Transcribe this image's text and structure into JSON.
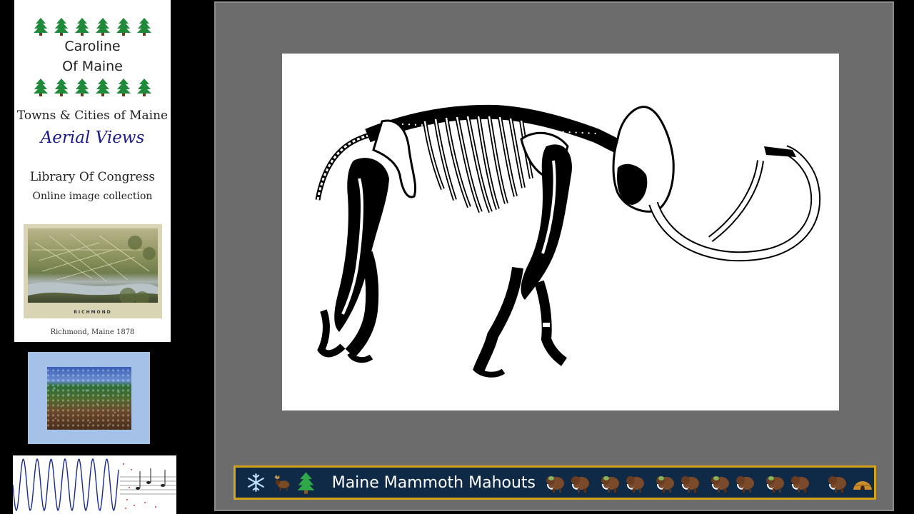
{
  "card": {
    "name_line1": "Caroline",
    "name_line2": "Of Maine",
    "heading": "Towns & Cities of Maine",
    "aerial": "Aerial Views",
    "source_line1": "Library Of Congress",
    "source_line2": "Online image collection",
    "map_caption": "Richmond, Maine 1878",
    "map_print_title": "RICHMOND"
  },
  "banner": {
    "title": "Maine Mammoth Mahouts",
    "icons": [
      "snowflake-icon",
      "moose-icon",
      "tree-icon",
      "mammoth-icon",
      "mammoth-icon",
      "mammoth-icon",
      "mammoth-icon",
      "mammoth-icon",
      "mammoth-icon",
      "mammoth-icon",
      "mammoth-icon",
      "mammoth-icon",
      "mammoth-icon",
      "mammoth-icon",
      "hut-icon"
    ]
  },
  "colors": {
    "stage_bg": "#6c6c6c",
    "banner_bg": "#0e2a47",
    "banner_border": "#d3a41b",
    "aerial_text": "#1a1a8a",
    "painting_frame": "#a4c2e8"
  }
}
